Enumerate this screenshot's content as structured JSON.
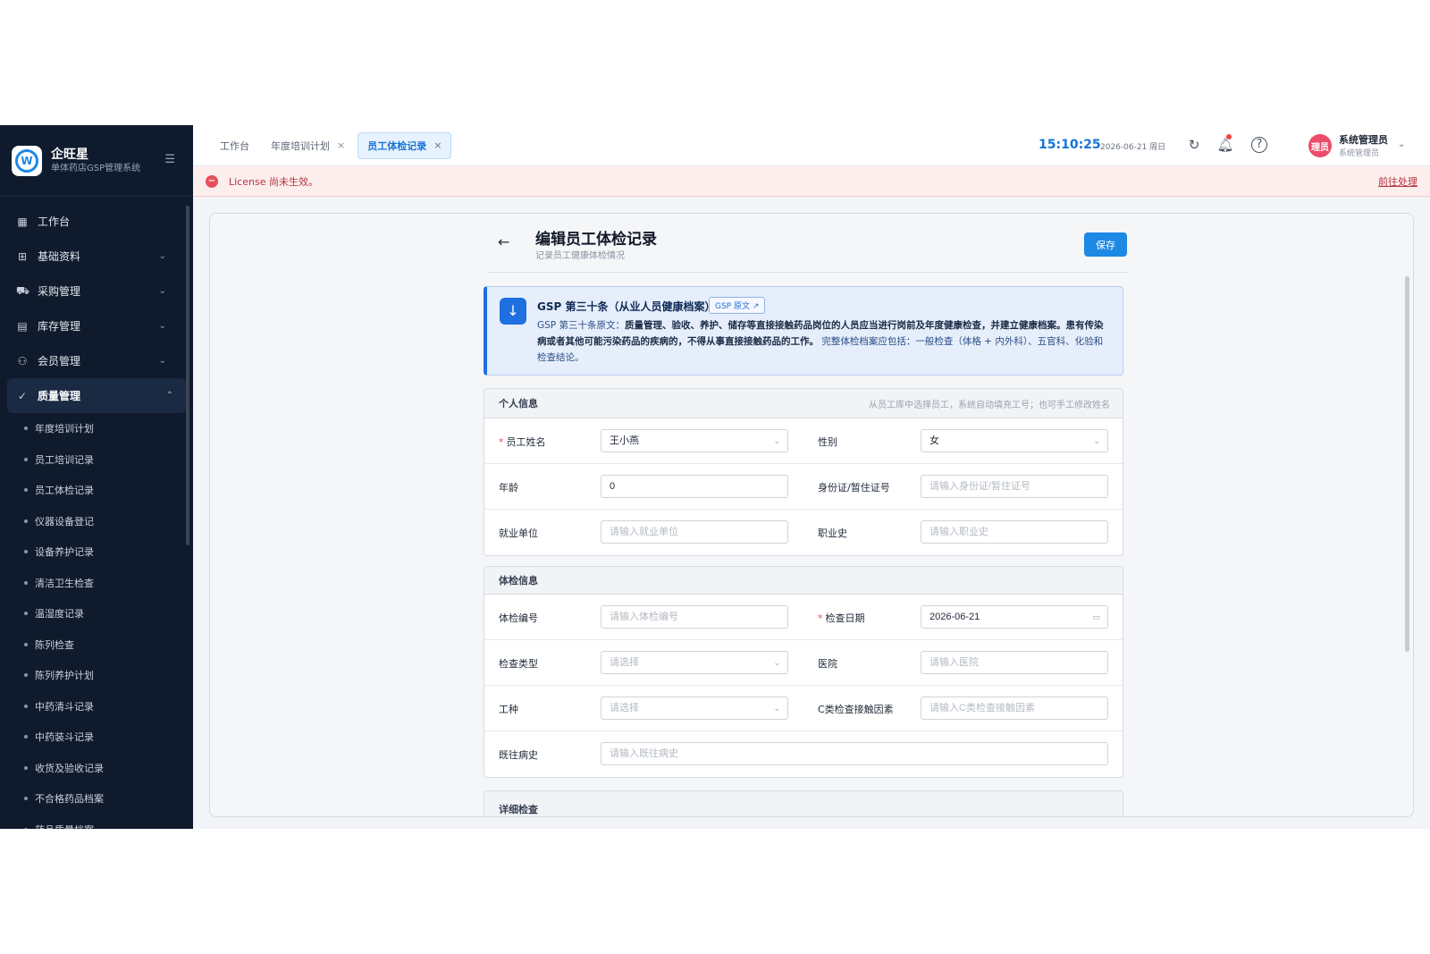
{
  "brand": {
    "name": "企旺星",
    "subtitle": "单体药店GSP管理系统",
    "logo_letter": "W"
  },
  "sidebar": {
    "items": [
      {
        "label": "工作台",
        "icon": "dashboard-icon",
        "glyph": "▦",
        "chevron": ""
      },
      {
        "label": "基础资料",
        "icon": "grid-icon",
        "glyph": "⊞",
        "chevron": "⌄"
      },
      {
        "label": "采购管理",
        "icon": "cart-icon",
        "glyph": "⛟",
        "chevron": "⌄"
      },
      {
        "label": "库存管理",
        "icon": "box-icon",
        "glyph": "▤",
        "chevron": "⌄"
      },
      {
        "label": "会员管理",
        "icon": "users-icon",
        "glyph": "⚇",
        "chevron": "⌄"
      },
      {
        "label": "质量管理",
        "icon": "check-circle-icon",
        "glyph": "✓",
        "chevron": "⌃"
      }
    ],
    "sub_items": [
      "年度培训计划",
      "员工培训记录",
      "员工体检记录",
      "仪器设备登记",
      "设备养护记录",
      "清洁卫生检查",
      "温湿度记录",
      "陈列检查",
      "陈列养护计划",
      "中药清斗记录",
      "中药装斗记录",
      "收货及验收记录",
      "不合格药品档案",
      "药品质量档案"
    ]
  },
  "tabs": [
    {
      "label": "工作台",
      "closable": false
    },
    {
      "label": "年度培训计划",
      "closable": true
    },
    {
      "label": "员工体检记录",
      "closable": true,
      "active": true
    }
  ],
  "header": {
    "time": "15:10:25",
    "date": "2026-06-21 周日",
    "user_name": "系统管理员",
    "user_role": "系统管理员",
    "avatar_text": "理员"
  },
  "license": {
    "message": "License 尚未生效。",
    "action": "前往处理"
  },
  "page": {
    "title": "编辑员工体检记录",
    "subtitle": "记录员工健康体检情况",
    "save_label": "保存"
  },
  "notice": {
    "title": "GSP 第三十条（从业人员健康档案）",
    "tag": "GSP 原文 ↗",
    "prefix": "GSP 第三十条原文：",
    "bold": "质量管理、验收、养护、储存等直接接触药品岗位的人员应当进行岗前及年度健康检查，并建立健康档案。患有传染病或者其他可能污染药品的疾病的，不得从事直接接触药品的工作。",
    "suffix": "完整体检档案应包括：一般检查（体格 + 内外科）、五官科、化验和检查结论。"
  },
  "personal": {
    "title": "个人信息",
    "hint": "从员工库中选择员工，系统自动填充工号；也可手工修改姓名",
    "name_label": "员工姓名",
    "name_value": "王小燕",
    "gender_label": "性别",
    "gender_value": "女",
    "age_label": "年龄",
    "age_value": "0",
    "id_label": "身份证/暂住证号",
    "id_placeholder": "请输入身份证/暂住证号",
    "employer_label": "就业单位",
    "employer_placeholder": "请输入就业单位",
    "history_label": "职业史",
    "history_placeholder": "请输入职业史"
  },
  "exam": {
    "title": "体检信息",
    "no_label": "体检编号",
    "no_placeholder": "请输入体检编号",
    "date_label": "检查日期",
    "date_value": "2026-06-21",
    "type_label": "检查类型",
    "type_placeholder": "请选择",
    "hospital_label": "医院",
    "hospital_placeholder": "请输入医院",
    "job_label": "工种",
    "job_placeholder": "请选择",
    "factor_label": "C类检查接触因素",
    "factor_placeholder": "请输入C类检查接触因素",
    "past_label": "既往病史",
    "past_placeholder": "请输入既往病史"
  },
  "detail": {
    "title": "详细检查"
  },
  "colors": {
    "primary": "#1e88e5",
    "sidebar": "#0f1b2d",
    "danger": "#e4505a"
  }
}
